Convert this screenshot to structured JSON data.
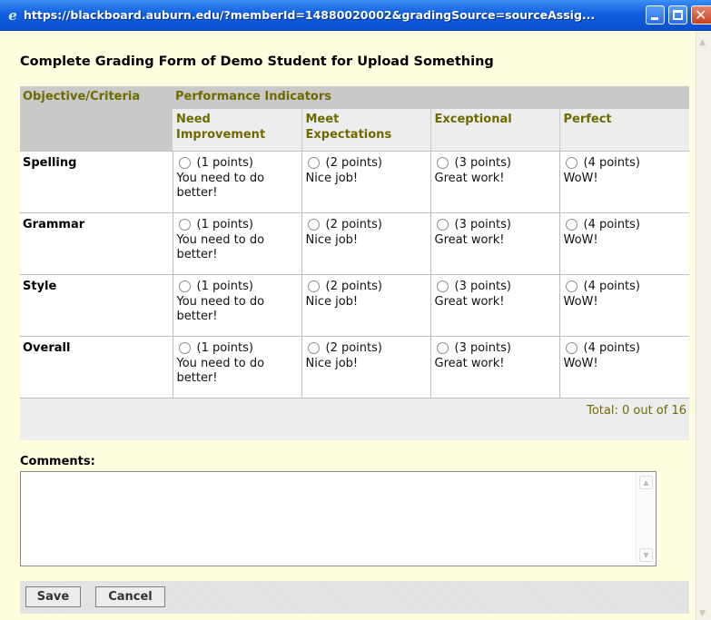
{
  "window": {
    "title": "https://blackboard.auburn.edu/?memberId=14880020002&gradingSource=sourceAssig..."
  },
  "page": {
    "title": "Complete Grading Form of Demo Student for Upload Something"
  },
  "rubric": {
    "col_objective": "Objective/Criteria",
    "col_performance": "Performance Indicators",
    "levels": [
      {
        "name": "Need Improvement"
      },
      {
        "name": "Meet Expectations"
      },
      {
        "name": "Exceptional"
      },
      {
        "name": "Perfect"
      }
    ],
    "criteria": [
      {
        "name": "Spelling",
        "cells": [
          {
            "points": "(1 points)",
            "feedback": "You need to do better!"
          },
          {
            "points": "(2 points)",
            "feedback": "Nice job!"
          },
          {
            "points": "(3 points)",
            "feedback": "Great work!"
          },
          {
            "points": "(4 points)",
            "feedback": "WoW!"
          }
        ]
      },
      {
        "name": "Grammar",
        "cells": [
          {
            "points": "(1 points)",
            "feedback": "You need to do better!"
          },
          {
            "points": "(2 points)",
            "feedback": "Nice job!"
          },
          {
            "points": "(3 points)",
            "feedback": "Great work!"
          },
          {
            "points": "(4 points)",
            "feedback": "WoW!"
          }
        ]
      },
      {
        "name": "Style",
        "cells": [
          {
            "points": "(1 points)",
            "feedback": "You need to do better!"
          },
          {
            "points": "(2 points)",
            "feedback": "Nice job!"
          },
          {
            "points": "(3 points)",
            "feedback": "Great work!"
          },
          {
            "points": "(4 points)",
            "feedback": "WoW!"
          }
        ]
      },
      {
        "name": "Overall",
        "cells": [
          {
            "points": "(1 points)",
            "feedback": "You need to do better!"
          },
          {
            "points": "(2 points)",
            "feedback": "Nice job!"
          },
          {
            "points": "(3 points)",
            "feedback": "Great work!"
          },
          {
            "points": "(4 points)",
            "feedback": "WoW!"
          }
        ]
      }
    ],
    "total": "Total: 0 out of 16"
  },
  "comments": {
    "label": "Comments:",
    "value": ""
  },
  "buttons": {
    "save": "Save",
    "cancel": "Cancel"
  },
  "colors": {
    "titlebar": "#1161e0",
    "page_background": "#fffde0",
    "header_text": "#6e6a00",
    "header_background": "#c9c9c9"
  },
  "icons": {
    "browser": "ie-icon",
    "minimize": "minimize-icon",
    "maximize": "maximize-icon",
    "close": "close-icon"
  }
}
